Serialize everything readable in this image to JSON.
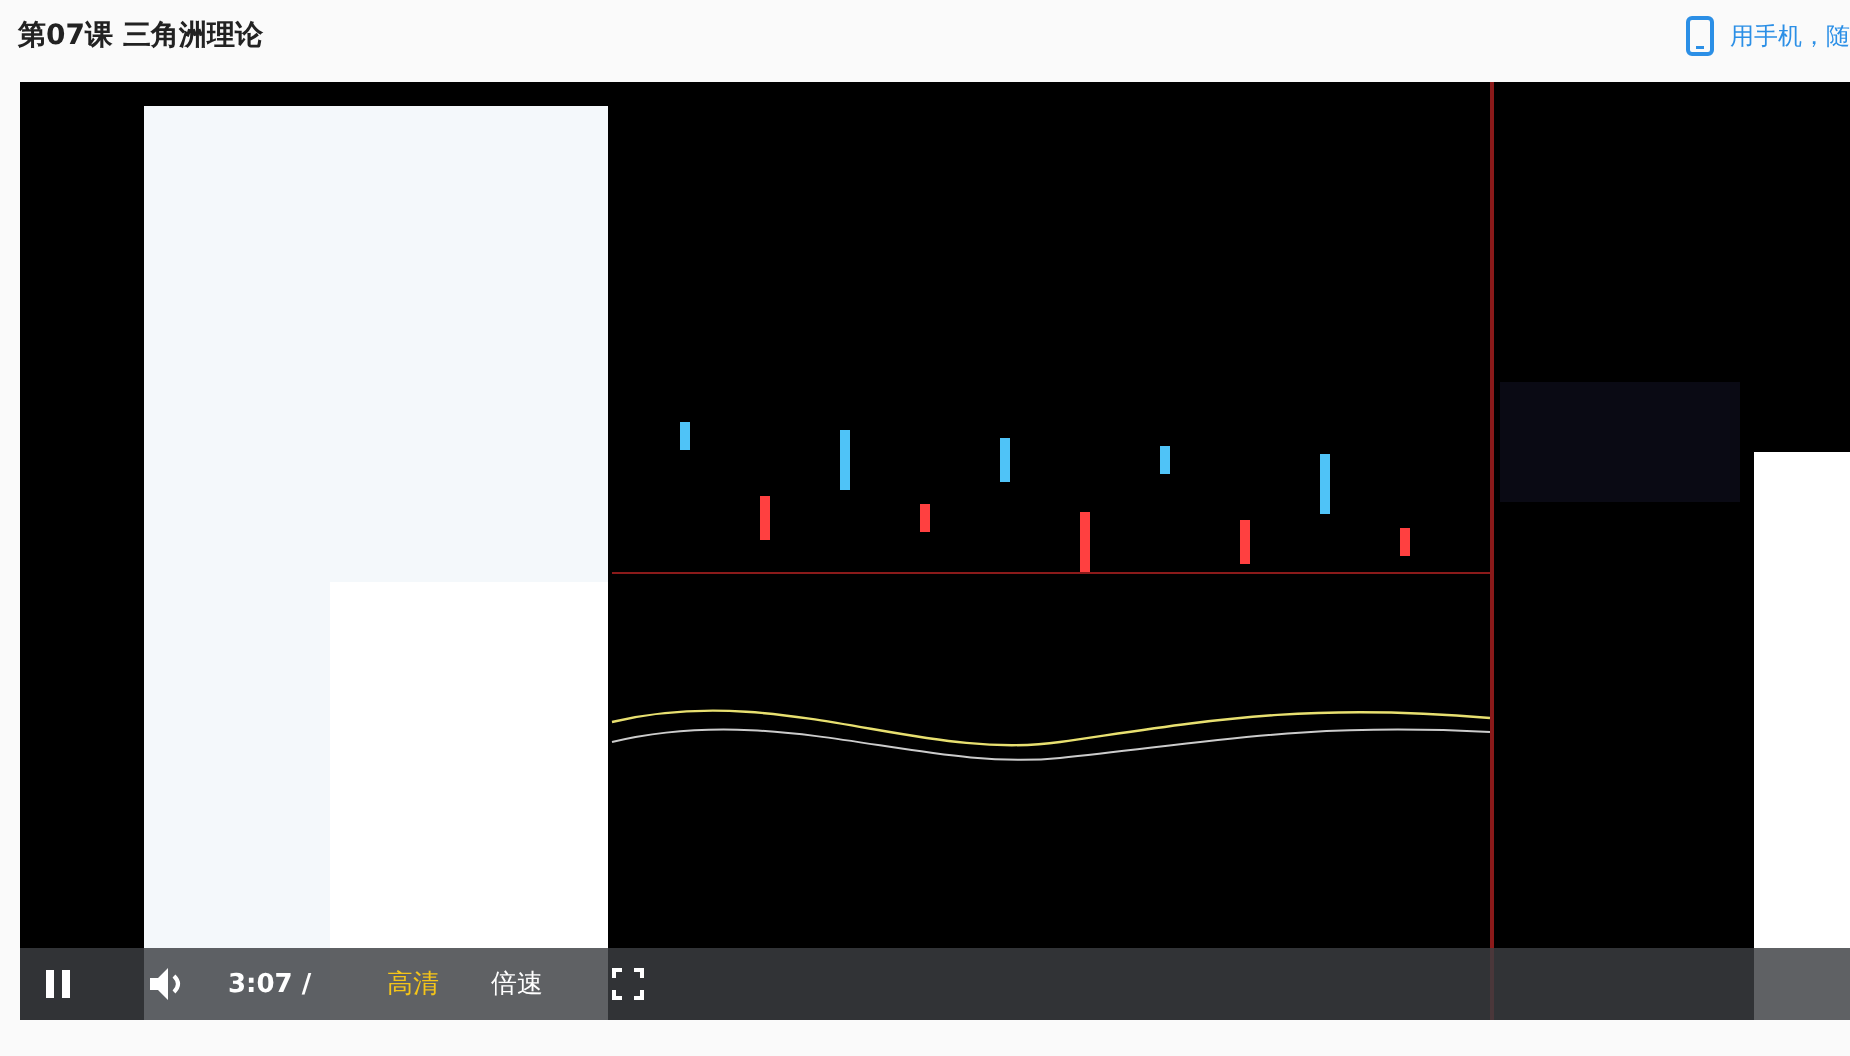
{
  "header": {
    "title": "第07课 三角洲理论",
    "mobile_link": "用手机，随"
  },
  "player": {
    "playing": true,
    "time": "3:07 /",
    "buttons": [
      {
        "label": "高清",
        "active": true
      },
      {
        "label": "倍速",
        "active": false
      }
    ]
  }
}
